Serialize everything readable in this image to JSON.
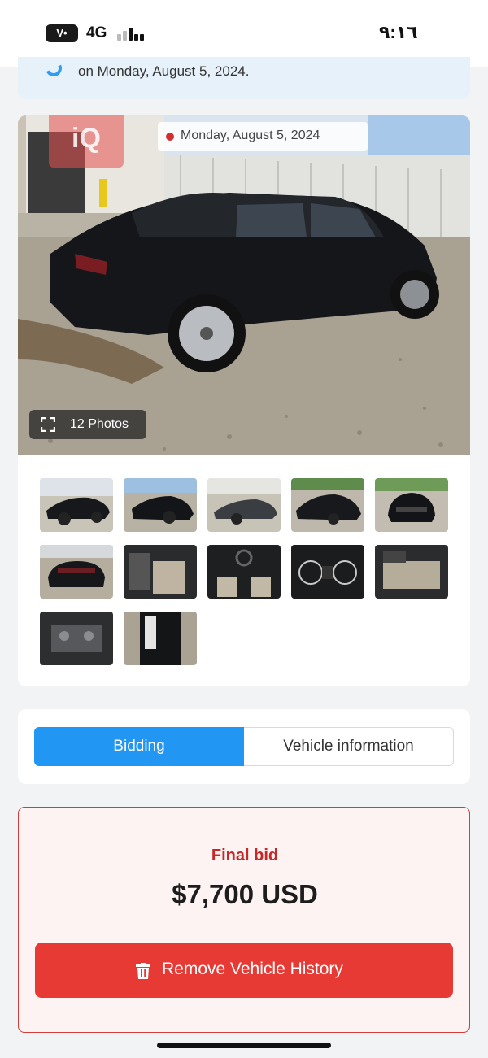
{
  "status_bar": {
    "carrier": "V•",
    "network": "4G",
    "time": "٩:١٦"
  },
  "notice": {
    "text": "on Monday, August 5, 2024."
  },
  "gallery": {
    "date_chip": "Monday, August 5, 2024",
    "logo_text": "iQ",
    "photos_button": "12 Photos",
    "thumbnails": [
      {
        "name": "thumb-side-left",
        "icon": "car-side"
      },
      {
        "name": "thumb-rear-right",
        "icon": "car-rear"
      },
      {
        "name": "thumb-side-right",
        "icon": "car-side"
      },
      {
        "name": "thumb-front-left",
        "icon": "car-front"
      },
      {
        "name": "thumb-front",
        "icon": "car-front"
      },
      {
        "name": "thumb-rear-damage",
        "icon": "car-rear"
      },
      {
        "name": "thumb-interior-front",
        "icon": "seat"
      },
      {
        "name": "thumb-dashboard",
        "icon": "dashboard"
      },
      {
        "name": "thumb-cluster",
        "icon": "gauge"
      },
      {
        "name": "thumb-rear-seats",
        "icon": "seat"
      },
      {
        "name": "thumb-engine",
        "icon": "engine"
      },
      {
        "name": "thumb-door-label",
        "icon": "door"
      }
    ]
  },
  "tabs": {
    "bidding": "Bidding",
    "vehicle_info": "Vehicle information",
    "active": "bidding"
  },
  "bid": {
    "label": "Final bid",
    "amount": "$7,700 USD",
    "remove_button": "Remove Vehicle History"
  },
  "colors": {
    "accent": "#2196f3",
    "danger": "#e83a34",
    "danger_text": "#c62828"
  }
}
